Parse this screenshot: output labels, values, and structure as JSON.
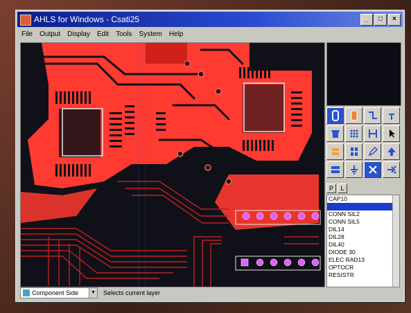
{
  "window": {
    "title": "AHLS for Windows - Csati25",
    "controls": [
      "_",
      "□",
      "×"
    ]
  },
  "menu": [
    "File",
    "Output",
    "Display",
    "Edit",
    "Tools",
    "System",
    "Help"
  ],
  "toolbar_icons": [
    "via-tool-icon",
    "pad-tool-icon",
    "track-tool-icon",
    "pointer-arrow-icon",
    "component-tool-icon",
    "grid-tool-icon",
    "connect-tool-icon",
    "select-arrow-icon",
    "fill-tool-icon",
    "pins-tool-icon",
    "edit-tool-icon",
    "up-arrow-icon",
    "layer-tool-icon",
    "ground-tool-icon",
    "delete-tool-icon",
    "route-tool-icon"
  ],
  "library": {
    "tabs": [
      "P",
      "L"
    ],
    "items": [
      "CAP10",
      "",
      "CONN SIL2",
      "CONN SIL5",
      "DIL14",
      "DIL28",
      "DIL40",
      "DIODE 30",
      "ELEC RAD13",
      "OPTOCR",
      "RESISTR"
    ],
    "selected_index": 1
  },
  "status": {
    "layer": "Component Side",
    "hint": "Selects current layer"
  },
  "colors": {
    "copper": "#ff3a30",
    "board_bg": "#101018",
    "silkscreen": "#e8e8e8",
    "tracks": "#c02020"
  }
}
